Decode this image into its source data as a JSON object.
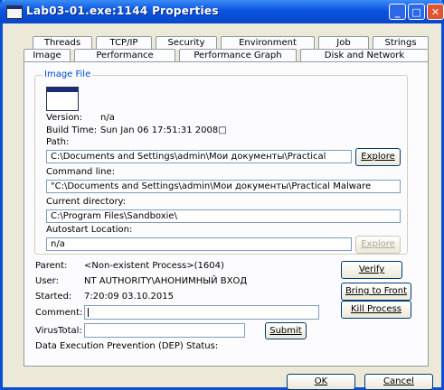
{
  "window": {
    "title": "Lab03-01.exe:1144 Properties"
  },
  "tabs": {
    "row1": [
      "Threads",
      "TCP/IP",
      "Security",
      "Environment",
      "Job",
      "Strings"
    ],
    "row2": [
      "Image",
      "Performance",
      "Performance Graph",
      "Disk and Network"
    ],
    "active": "Image"
  },
  "image_file": {
    "group_title": "Image File",
    "version_label": "Version:",
    "version_value": "n/a",
    "build_time_label": "Build Time:",
    "build_time_value": "Sun Jan 06 17:51:31 2008□",
    "path_label": "Path:",
    "path_value": "C:\\Documents and Settings\\admin\\Мои документы\\Practical",
    "explore_label": "Explore",
    "command_line_label": "Command line:",
    "command_line_value": "\"C:\\Documents and Settings\\admin\\Мои документы\\Practical Malware",
    "current_dir_label": "Current directory:",
    "current_dir_value": "C:\\Program Files\\Sandboxie\\",
    "autostart_label": "Autostart Location:",
    "autostart_value": "n/a",
    "explore_disabled_label": "Explore"
  },
  "details": {
    "parent_label": "Parent:",
    "parent_value": "<Non-existent Process>(1604)",
    "user_label": "User:",
    "user_value": "NT AUTHORITY\\АНОНИМНЫЙ ВХОД",
    "started_label": "Started:",
    "started_value": "7:20:09  03.10.2015",
    "comment_label": "Comment:",
    "comment_value": "",
    "virustotal_label": "VirusTotal:",
    "submit_label": "Submit",
    "dep_label": "Data Execution Prevention (DEP) Status:"
  },
  "side_buttons": {
    "verify": "Verify",
    "bring_to_front": "Bring to Front",
    "kill_process": "Kill Process"
  },
  "dialog_buttons": {
    "ok": "OK",
    "cancel": "Cancel"
  }
}
